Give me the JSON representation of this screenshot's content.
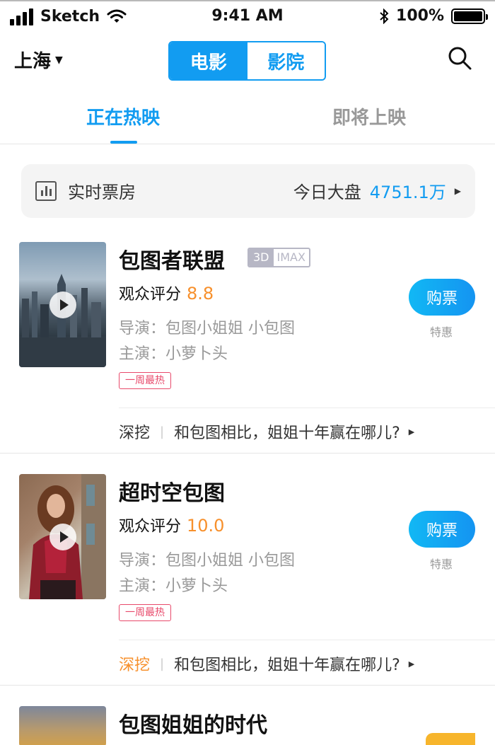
{
  "status_bar": {
    "carrier": "Sketch",
    "time": "9:41 AM",
    "battery_percent": "100%",
    "signal_icon": "signal-icon",
    "wifi_icon": "wifi-icon",
    "bluetooth_icon": "bluetooth-icon"
  },
  "nav": {
    "city": "上海",
    "segments": [
      "电影",
      "影院"
    ],
    "active_segment": "电影",
    "search_icon": "search-icon"
  },
  "tabs": {
    "items": [
      "正在热映",
      "即将上映"
    ],
    "active": "正在热映"
  },
  "box_office": {
    "label": "实时票房",
    "today_label": "今日大盘",
    "today_value": "4751.1万"
  },
  "movies": [
    {
      "title": "包图者联盟",
      "formats": [
        "3D",
        "IMAX"
      ],
      "rating_label": "观众评分",
      "score": "8.8",
      "director": "导演：包图小姐姐 小包图",
      "cast": "主演：小萝卜头",
      "badge": "一周最热",
      "buy_label": "购票",
      "special": "特惠",
      "dig_label": "深挖",
      "dig_text": "和包图相比，姐姐十年赢在哪儿?"
    },
    {
      "title": "超时空包图",
      "rating_label": "观众评分",
      "score": "10.0",
      "director": "导演：包图小姐姐 小包图",
      "cast": "主演：小萝卜头",
      "badge": "一周最热",
      "buy_label": "购票",
      "special": "特惠",
      "dig_label": "深挖",
      "dig_text": "和包图相比，姐姐十年赢在哪儿?"
    },
    {
      "title": "包图姐姐的时代"
    }
  ],
  "colors": {
    "accent": "#129cf1",
    "score": "#f7902c",
    "badge": "#e84a6b",
    "muted": "#999999"
  }
}
